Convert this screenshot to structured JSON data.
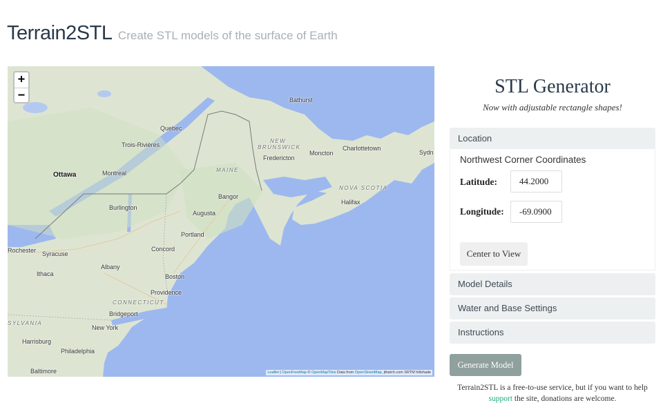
{
  "header": {
    "title": "Terrain2STL",
    "tagline": "Create STL models of the surface of Earth"
  },
  "map": {
    "zoom_in": "+",
    "zoom_out": "−",
    "labels": {
      "bathurst": "Bathurst",
      "quebec": "Quebec",
      "new": "NEW",
      "brunswick": "BRUNSWICK",
      "charlottetown": "Charlottetown",
      "sydney": "Sydn",
      "trois_rivieres": "Trois-Rivières",
      "fredericton": "Fredericton",
      "moncton": "Moncton",
      "ottawa": "Ottawa",
      "montreal": "Montreal",
      "maine": "MAINE",
      "nova_scotia": "NOVA SCOTIA",
      "bangor": "Bangor",
      "halifax": "Halifax",
      "burlington": "Burlington",
      "augusta": "Augusta",
      "portland": "Portland",
      "rochester": "Rochester",
      "syracuse": "Syracuse",
      "concord": "Concord",
      "albany": "Albany",
      "ithaca": "Ithaca",
      "boston": "Boston",
      "connecticut": "CONNECTICUT",
      "providence": "Providence",
      "bridgeport": "Bridgeport",
      "pennsylvania": "SYLVANIA",
      "new_york": "New York",
      "harrisburg": "Harrisburg",
      "philadelphia": "Philadelphia",
      "baltimore": "Baltimore"
    },
    "attribution": {
      "leaflet": "Leaflet",
      "sep": " | ",
      "openfreemap": "OpenFreeMap",
      "copy": " © ",
      "openmaptiles": "OpenMapTiles",
      "data_from": " Data from ",
      "osm": "OpenStreetMap",
      "rest": ", jthatch.com SRTM hillshade"
    }
  },
  "panel": {
    "title": "STL Generator",
    "subtitle": "Now with adjustable rectangle shapes!",
    "sections": {
      "location": "Location",
      "model_details": "Model Details",
      "water_base": "Water and Base Settings",
      "instructions": "Instructions"
    },
    "coords_heading": "Northwest Corner Coordinates",
    "latitude_label": "Latitude:",
    "latitude_value": "44.2000",
    "longitude_label": "Longitude:",
    "longitude_value": "-69.0900",
    "center_button": "Center to View",
    "generate_button": "Generate Model"
  },
  "footer": {
    "text_before": "Terrain2STL is a free-to-use service, but if you want to help ",
    "link": "support",
    "text_after": " the site, donations are welcome."
  },
  "colors": {
    "ocean": "#9db8ee",
    "land": "#dde5d2",
    "accent_link": "#19a974",
    "generate_button": "#8fa09d",
    "section_bg": "#edf0f0"
  }
}
